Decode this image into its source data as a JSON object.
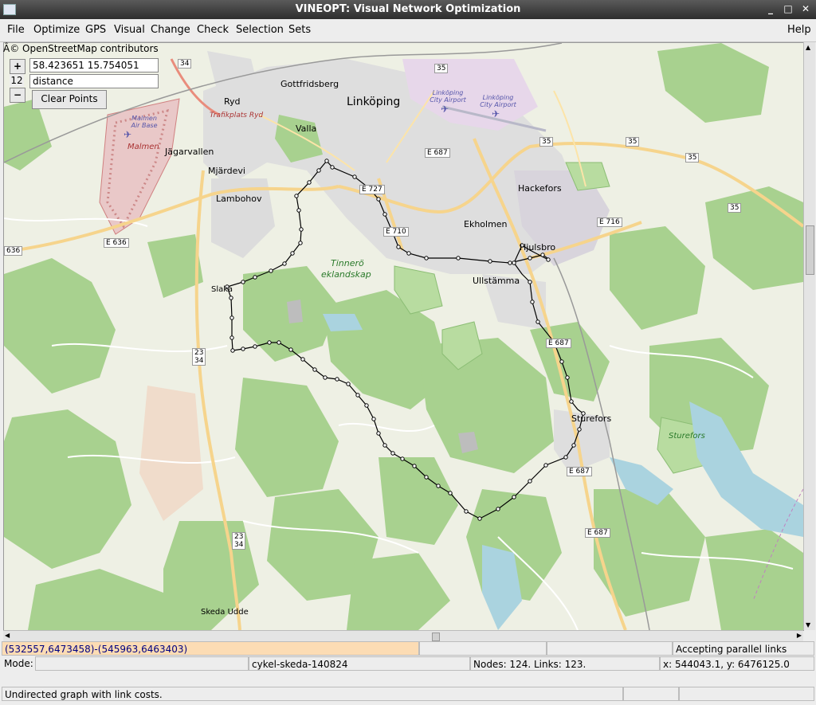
{
  "window": {
    "title": "VINEOPT: Visual Network Optimization",
    "controls": [
      "_",
      "□",
      "✕"
    ]
  },
  "menu": {
    "items": [
      "File",
      "Optimize",
      "GPS",
      "Visual",
      "Change",
      "Check",
      "Selection",
      "Sets"
    ],
    "help": "Help"
  },
  "map": {
    "attribution": "Â© OpenStreetMap contributors",
    "coord_input": "58.423651 15.754051",
    "zoom_level": "12",
    "zoom_in": "+",
    "zoom_out": "−",
    "mode_input": "distance",
    "clear_button": "Clear Points",
    "place_labels": {
      "gottfridsberg": "Gottfridsberg",
      "linkoping": "Linköping",
      "ryd": "Ryd",
      "valla": "Valla",
      "jagarvallen": "Jägarvallen",
      "mjardevi": "Mjärdevi",
      "lambohov": "Lambohov",
      "hackefors": "Hackefors",
      "ekholmen": "Ekholmen",
      "hjulsbro": "Hjulsbro",
      "ullstamma": "Ullstämma",
      "slaka": "Slaka",
      "sturefors": "Sturefors",
      "skeda_udde": "Skeda Udde",
      "malmen": "Malmen",
      "malmen_air_base": "Malmen Air Base",
      "trafikplats_ryd": "Trafikplats Ryd",
      "city_airport_1": "Linköping City Airport",
      "city_airport_2": "Linköping City Airport",
      "tinnero_1": "Tinnerö",
      "tinnero_2": "eklandskap",
      "sturefors_park": "Sturefors"
    },
    "road_labels": {
      "r34": "34",
      "r35a": "35",
      "r35b": "35",
      "r35c": "35",
      "r35d": "35",
      "r35e": "35",
      "e636": "E 636",
      "r636": "636",
      "e687a": "E 687",
      "e687b": "E 687",
      "e687c": "E 687",
      "e687d": "E 687",
      "e716": "E 716",
      "e727": "E 727",
      "e710": "E 710",
      "r23_34a_1": "23",
      "r23_34a_2": "34",
      "r23_34b_1": "23",
      "r23_34b_2": "34"
    }
  },
  "status": {
    "extent": "(532557,6473458)-(545963,6463403)",
    "parallel_links": "Accepting parallel links",
    "mode_label": "Mode:",
    "network_name": "cykel-skeda-140824",
    "counts": "Nodes: 124. Links: 123.",
    "cursor_xy": "x: 544043.1, y: 6476125.0",
    "graph_type": "Undirected graph with link costs."
  },
  "colors": {
    "route": "#000000",
    "forest": "#a8d18f",
    "water": "#aad3df",
    "urban": "#dcdcdc",
    "road_major": "#f6d48c",
    "road_minor": "#ffffff",
    "status_highlight": "#fcdcb4",
    "extent_text": "#000080"
  }
}
